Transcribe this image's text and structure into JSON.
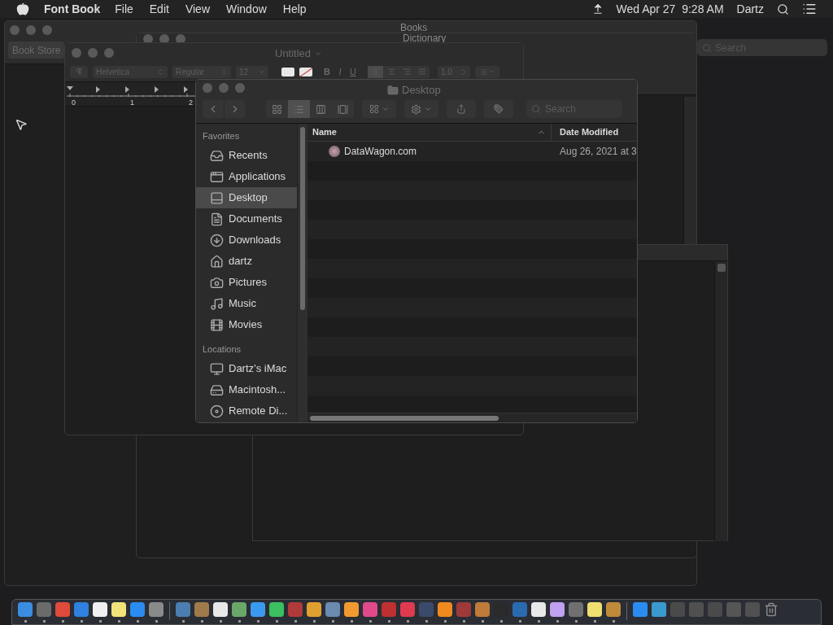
{
  "menu_bar": {
    "app": "Font Book",
    "menus": [
      "File",
      "Edit",
      "View",
      "Window",
      "Help"
    ],
    "clock": "Wed Apr 27  9:28 AM",
    "user": "Dartz"
  },
  "books_window": {
    "title": "Books",
    "toolbar_button": "Book Store",
    "search_placeholder": "Search"
  },
  "dictionary_window": {
    "title": "Dictionary"
  },
  "textedit_window": {
    "title": "Untitled",
    "font": "Helvetica",
    "style": "Regular",
    "size": "12",
    "format_buttons": [
      "B",
      "I",
      "U"
    ],
    "alignments": [
      {
        "selected": true
      },
      {
        "selected": false
      },
      {
        "selected": false
      },
      {
        "selected": false
      }
    ],
    "spacing": "1.0",
    "ruler": [
      "0",
      "1",
      "2"
    ]
  },
  "finder_window": {
    "title": "Desktop",
    "search_placeholder": "Search",
    "views": [
      {
        "selected": false
      },
      {
        "selected": true
      },
      {
        "selected": false
      },
      {
        "selected": false
      }
    ],
    "sidebar": [
      {
        "heading": "Favorites",
        "items": [
          {
            "label": "Recents",
            "selected": false
          },
          {
            "label": "Applications",
            "selected": false
          },
          {
            "label": "Desktop",
            "selected": true
          },
          {
            "label": "Documents",
            "selected": false
          },
          {
            "label": "Downloads",
            "selected": false
          },
          {
            "label": "dartz",
            "selected": false
          },
          {
            "label": "Pictures",
            "selected": false
          },
          {
            "label": "Music",
            "selected": false
          },
          {
            "label": "Movies",
            "selected": false
          }
        ]
      },
      {
        "heading": "Locations",
        "items": [
          {
            "label": "Dartz’s iMac",
            "selected": false
          },
          {
            "label": "Macintosh...",
            "selected": false
          },
          {
            "label": "Remote Di...",
            "selected": false
          }
        ]
      }
    ],
    "columns": [
      "Name",
      "Date Modified"
    ],
    "rows": [
      {
        "name": "DataWagon.com",
        "date": "Aug 26, 2021 at 3"
      }
    ]
  },
  "dock": {
    "apps": [
      {
        "running": true
      },
      {
        "running": true
      },
      {
        "running": true
      },
      {
        "running": true
      },
      {
        "running": true
      },
      {
        "running": true
      },
      {
        "running": true
      },
      {
        "running": true
      },
      {
        "running": true
      },
      {
        "running": true
      },
      {
        "running": true
      },
      {
        "running": true
      },
      {
        "running": true
      },
      {
        "running": true
      },
      {
        "running": true
      },
      {
        "running": true
      },
      {
        "running": true
      },
      {
        "running": true
      },
      {
        "running": true
      },
      {
        "running": true
      },
      {
        "running": true
      },
      {
        "running": true
      },
      {
        "running": true
      },
      {
        "running": true
      },
      {
        "running": true
      },
      {
        "running": true
      },
      {
        "running": true
      },
      {
        "running": true
      },
      {
        "running": true
      },
      {
        "running": true
      },
      {
        "running": true
      },
      {
        "running": true
      }
    ]
  }
}
